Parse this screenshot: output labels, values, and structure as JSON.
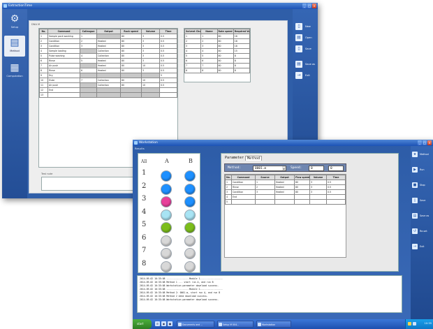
{
  "colors": {
    "titlebar": "#1c52b4",
    "app_bg": "#2f5ea8",
    "well_blue": "#1e90ff",
    "well_pink": "#e8409a",
    "well_light_blue": "#a8e4f4",
    "well_green": "#7cbd1c",
    "well_empty": "#d8d8d8"
  },
  "win1": {
    "title": "ExtractionTime",
    "nav": [
      {
        "icon": "gear-icon",
        "label": "Setup"
      },
      {
        "icon": "document-icon",
        "label": "Method"
      },
      {
        "icon": "report-icon",
        "label": "Computation"
      }
    ],
    "right": [
      {
        "icon": "new-icon",
        "label": "New"
      },
      {
        "icon": "open-icon",
        "label": "Open"
      },
      {
        "icon": "save-icon",
        "label": "Save"
      },
      {
        "icon": "save-as-icon",
        "label": "Save as"
      },
      {
        "icon": "exit-icon",
        "label": "Exit"
      }
    ],
    "field_label": "DNA M",
    "table_headers": [
      "No.",
      "Command",
      "Colleague",
      "Output",
      "Rack speed",
      "Volume",
      "Time"
    ],
    "table_rows": [
      [
        "1",
        "Sample pack washing",
        "1",
        "",
        "80",
        "3",
        "0.5"
      ],
      [
        "2",
        "Condition",
        "2",
        "Heated",
        "80",
        "3",
        "0.5"
      ],
      [
        "3",
        "Condition",
        "3",
        "Heated",
        "80",
        "3",
        "0.5"
      ],
      [
        "4",
        "Sample loading",
        "",
        "Collection",
        "80",
        "3",
        "0.5"
      ],
      [
        "5",
        "Pulse washing",
        "4",
        "Collection",
        "80",
        "3",
        "0.5"
      ],
      [
        "6",
        "Rinse",
        "5",
        "Heated",
        "80",
        "3",
        "0.5"
      ],
      [
        "7",
        "Air push",
        "",
        "Heated",
        "80",
        "10",
        "0.5"
      ],
      [
        "8",
        "Rinse",
        "6",
        "Heated",
        "80",
        "3",
        "0.5"
      ],
      [
        "9",
        "Dry",
        "",
        "",
        "",
        "",
        "5"
      ],
      [
        "10",
        "Elute",
        "7",
        "Collection",
        "80",
        "10",
        "0.5"
      ],
      [
        "11",
        "Air push",
        "",
        "Collection",
        "80",
        "10",
        "0.5"
      ],
      [
        "12",
        "End",
        "",
        "",
        "",
        "",
        ""
      ],
      [
        "13",
        "",
        "",
        "",
        "",
        "",
        ""
      ]
    ],
    "side_headers": [
      "Solvent Channel",
      "Name",
      "Rate speed",
      "Required Volume"
    ],
    "side_rows": [
      [
        "1",
        "1",
        "80",
        "18"
      ],
      [
        "2",
        "2",
        "80",
        "18"
      ],
      [
        "3",
        "3",
        "80",
        "18"
      ],
      [
        "4",
        "4",
        "80",
        "15"
      ],
      [
        "5",
        "5",
        "80",
        "8"
      ],
      [
        "6",
        "6",
        "80",
        "8"
      ],
      [
        "7",
        "7",
        "80",
        "8"
      ],
      [
        "8",
        "8",
        "80",
        "8"
      ]
    ],
    "note_label": "Test note"
  },
  "win2": {
    "title": "Workstation",
    "subtitle": "Results",
    "trays": {
      "all_label": "All",
      "columns": [
        "A",
        "B"
      ],
      "rows": [
        {
          "label": "1",
          "a": "#1e90ff",
          "b": "#1e90ff"
        },
        {
          "label": "2",
          "a": "#1e90ff",
          "b": "#1e90ff"
        },
        {
          "label": "3",
          "a": "#e8409a",
          "b": "#1e90ff"
        },
        {
          "label": "4",
          "a": "#a8e4f4",
          "b": "#a8e4f4"
        },
        {
          "label": "5",
          "a": "#7cbd1c",
          "b": "#7cbd1c"
        },
        {
          "label": "6",
          "a": "#d8d8d8",
          "b": "#d8d8d8"
        },
        {
          "label": "7",
          "a": "#d8d8d8",
          "b": "#d8d8d8"
        },
        {
          "label": "8",
          "a": "#d8d8d8",
          "b": "#d8d8d8"
        }
      ]
    },
    "tabs": [
      "Parameter",
      "Method"
    ],
    "method_label": "Method:",
    "method_value": "0001.m",
    "speed_label": "Speed:",
    "speed_value_1": "0",
    "speed_value_2": "0",
    "method_headers": [
      "No.",
      "Command",
      "Source",
      "Output",
      "Flow speed",
      "Volume",
      "Time"
    ],
    "method_rows": [
      [
        "1",
        "Condition",
        "1",
        "Heated",
        "80",
        "3",
        "0.5"
      ],
      [
        "2",
        "Rinse",
        "2",
        "Heated",
        "80",
        "3",
        "0.5"
      ],
      [
        "3",
        "Condition",
        "3",
        "Heated",
        "80",
        "3",
        "0.5"
      ],
      [
        "4",
        "End",
        "",
        "",
        "",
        "",
        ""
      ],
      [
        "5",
        "",
        "",
        "",
        "",
        "",
        ""
      ]
    ],
    "log_lines": [
      "2014-09-02 10:35:08 -----------------Module 1-----------------",
      "2014-09-02 10:35:08  Method 1 ... start run A, and run B",
      "2014-09-02 10:35:08  Workstation parameter download success.",
      "2014-09-02 10:35:08 -----------------Module 2-----------------",
      "2014-09-02 10:35:08  Method 2: 0001.m, start run A, and run B",
      "2014-09-02 10:35:08  Method 2 data download success.",
      "2014-09-02 10:35:08  Workstation parameter download success."
    ],
    "right": [
      {
        "icon": "run-icon",
        "label": "Method"
      },
      {
        "icon": "play-icon",
        "label": "Run"
      },
      {
        "icon": "stop-icon",
        "label": "Stop"
      },
      {
        "icon": "save-icon",
        "label": "Save"
      },
      {
        "icon": "save-as-icon",
        "label": "Save as"
      },
      {
        "icon": "reset-icon",
        "label": "Re-set"
      },
      {
        "icon": "exit-icon",
        "label": "Exit"
      }
    ],
    "taskbar": {
      "start_label": "start",
      "tasks": [
        "Documents and ...",
        "Setup M 004...",
        "Workstation"
      ],
      "clock": "10:35"
    }
  }
}
